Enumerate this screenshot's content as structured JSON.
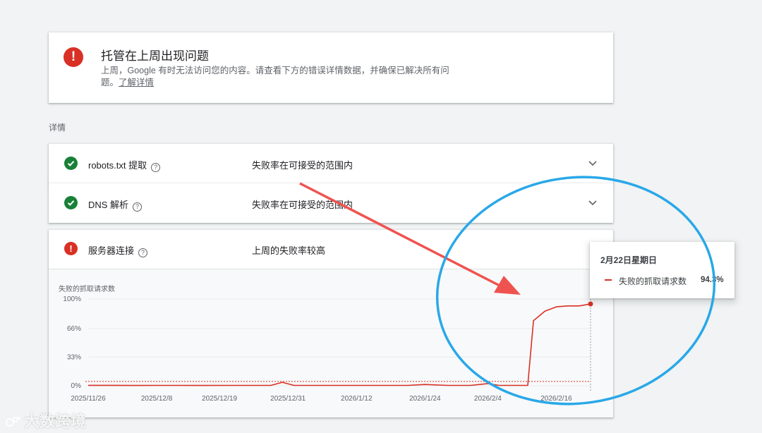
{
  "alert": {
    "title": "托管在上周出现问题",
    "body": "上周，Google 有时无法访问您的内容。请查看下方的错误详情数据，并确保已解决所有问题。",
    "link": "了解详情"
  },
  "details_label": "详情",
  "rows": [
    {
      "title": "robots.txt 提取",
      "status": "失败率在可接受的范围内",
      "state": "ok"
    },
    {
      "title": "DNS 解析",
      "status": "失败率在可接受的范围内",
      "state": "ok"
    },
    {
      "title": "服务器连接",
      "status": "上周的失败率较高",
      "state": "error"
    }
  ],
  "icons": {
    "ok": "check-icon",
    "error": "exclamation-icon",
    "help": "help-icon",
    "expand": "chevron-down-icon",
    "collapse": "chevron-up-icon"
  },
  "colors": {
    "ok": "#188038",
    "error": "#d93025",
    "annotation_arrow": "#ef5350",
    "annotation_circle": "#29a8e8"
  },
  "chart_data": {
    "type": "line",
    "ylabel": "失败的抓取请求数",
    "yticks": [
      "100%",
      "66%",
      "33%",
      "0%"
    ],
    "ylim": [
      0,
      100
    ],
    "xticks": [
      "2025/11/26",
      "2025/12/8",
      "2025/12/19",
      "2025/12/31",
      "2026/1/12",
      "2026/1/24",
      "2026/2/4",
      "2026/2/16"
    ],
    "x": [
      "2025/11/26",
      "2025/11/30",
      "2025/12/4",
      "2025/12/8",
      "2025/12/12",
      "2025/12/16",
      "2025/12/20",
      "2025/12/24",
      "2025/12/28",
      "2025/12/30",
      "2026/1/1",
      "2026/1/5",
      "2026/1/9",
      "2026/1/13",
      "2026/1/17",
      "2026/1/21",
      "2026/1/24",
      "2026/1/28",
      "2026/2/1",
      "2026/2/4",
      "2026/2/6",
      "2026/2/10",
      "2026/2/11",
      "2026/2/12",
      "2026/2/14",
      "2026/2/16",
      "2026/2/18",
      "2026/2/20",
      "2026/2/22"
    ],
    "series": [
      {
        "name": "失败的抓取请求数",
        "values": [
          0.5,
          0.5,
          0.3,
          0.4,
          0.4,
          0.3,
          0.4,
          0.4,
          0.4,
          4,
          0.5,
          0.4,
          0.4,
          0.4,
          0.4,
          0.4,
          1.5,
          0.4,
          0.4,
          2.5,
          0.4,
          0.4,
          0.5,
          75,
          86,
          91,
          92,
          92,
          94.3
        ]
      }
    ],
    "threshold": 5,
    "grid": true,
    "highlight": {
      "date": "2月22日星期日",
      "series": "失败的抓取请求数",
      "value": "94.3%"
    }
  },
  "watermark": "大数跨境"
}
